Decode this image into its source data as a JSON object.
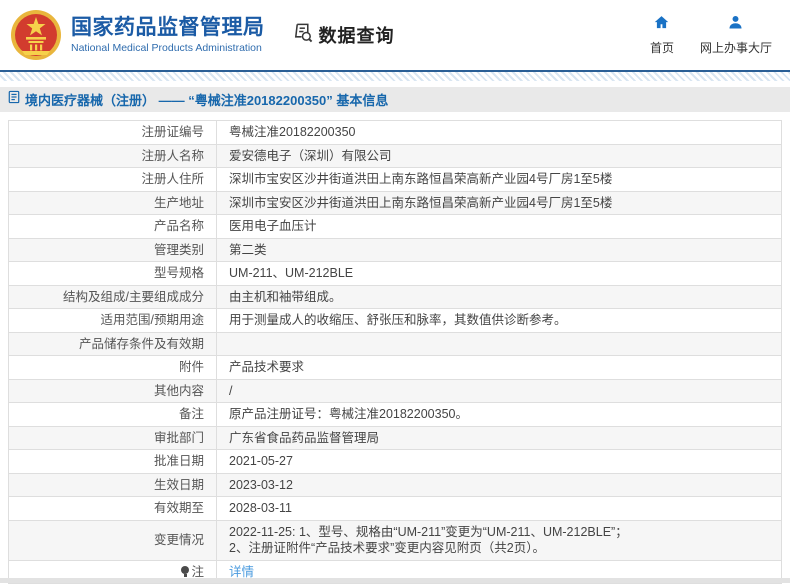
{
  "header": {
    "org_name_cn": "国家药品监督管理局",
    "org_name_en": "National Medical Products Administration",
    "section_title": "数据查询",
    "nav": [
      {
        "label": "首页",
        "icon": "home-icon"
      },
      {
        "label": "网上办事大厅",
        "icon": "person-icon"
      }
    ]
  },
  "breadcrumb": {
    "text": "境内医疗器械（注册） ——  “粤械注准20182200350”  基本信息"
  },
  "table": {
    "rows": [
      {
        "label": "注册证编号",
        "value": "粤械注准20182200350"
      },
      {
        "label": "注册人名称",
        "value": "爱安德电子（深圳）有限公司"
      },
      {
        "label": "注册人住所",
        "value": "深圳市宝安区沙井街道洪田上南东路恒昌荣高新产业园4号厂房1至5楼"
      },
      {
        "label": "生产地址",
        "value": "深圳市宝安区沙井街道洪田上南东路恒昌荣高新产业园4号厂房1至5楼"
      },
      {
        "label": "产品名称",
        "value": "医用电子血压计"
      },
      {
        "label": "管理类别",
        "value": "第二类"
      },
      {
        "label": "型号规格",
        "value": "UM-211、UM-212BLE"
      },
      {
        "label": "结构及组成/主要组成成分",
        "value": "由主机和袖带组成。"
      },
      {
        "label": "适用范围/预期用途",
        "value": "用于测量成人的收缩压、舒张压和脉率，其数值供诊断参考。"
      },
      {
        "label": "产品储存条件及有效期",
        "value": ""
      },
      {
        "label": "附件",
        "value": "产品技术要求"
      },
      {
        "label": "其他内容",
        "value": "/"
      },
      {
        "label": "备注",
        "value": "原产品注册证号：粤械注准20182200350。"
      },
      {
        "label": "审批部门",
        "value": "广东省食品药品监督管理局"
      },
      {
        "label": "批准日期",
        "value": "2021-05-27"
      },
      {
        "label": "生效日期",
        "value": "2023-03-12"
      },
      {
        "label": "有效期至",
        "value": "2028-03-11"
      },
      {
        "label": "变更情况",
        "value": "2022-11-25: 1、型号、规格由“UM-211”变更为“UM-211、UM-212BLE”；\n2、注册证附件“产品技术要求”变更内容见附页（共2页）。"
      },
      {
        "label": "注",
        "value": "详情",
        "link": true,
        "label_icon": "note-bulb-icon"
      }
    ]
  },
  "colors": {
    "brand_blue": "#1b5ba5",
    "nav_icon_blue": "#1a72c5",
    "breadcrumb_blue": "#1767ac",
    "link_blue": "#4a9bdf",
    "emblem_red": "#d23c2e",
    "emblem_gold": "#e9b63d",
    "alt_row_bg": "#f6f6f6"
  }
}
